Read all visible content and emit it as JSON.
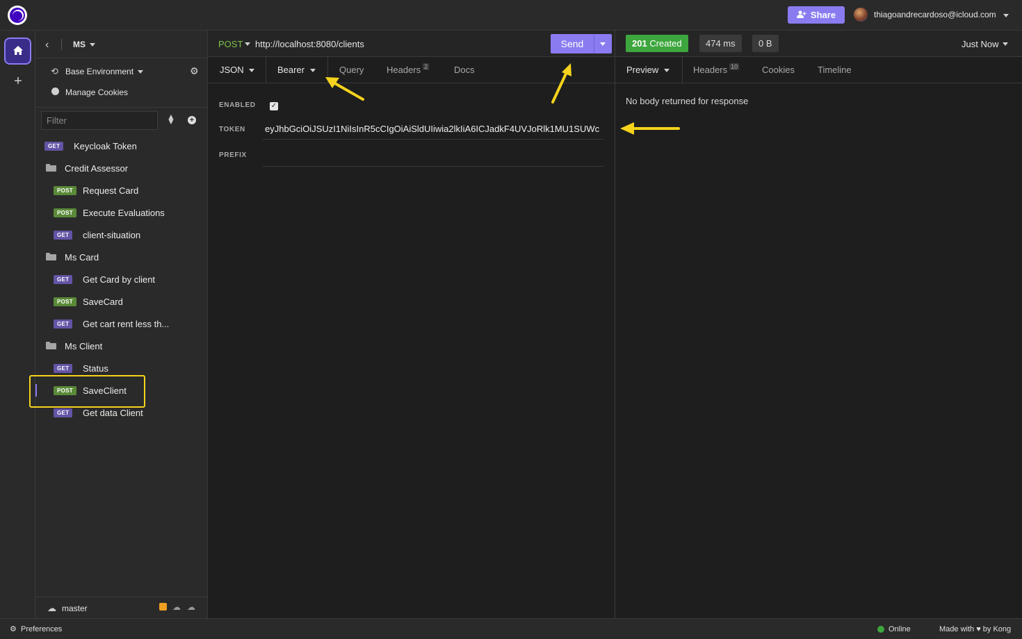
{
  "topbar": {
    "share_label": "Share",
    "user_email": "thiagoandrecardoso@icloud.com"
  },
  "sidebar": {
    "workspace": "MS",
    "environment": "Base Environment",
    "manage_cookies": "Manage Cookies",
    "filter_placeholder": "Filter",
    "items": [
      {
        "type": "request",
        "method": "GET",
        "label": "Keycloak Token",
        "depth": 0
      },
      {
        "type": "folder",
        "label": "Credit Assessor",
        "depth": 0
      },
      {
        "type": "request",
        "method": "POST",
        "label": "Request Card",
        "depth": 1
      },
      {
        "type": "request",
        "method": "POST",
        "label": "Execute Evaluations",
        "depth": 1
      },
      {
        "type": "request",
        "method": "GET",
        "label": "client-situation",
        "depth": 1
      },
      {
        "type": "folder",
        "label": "Ms Card",
        "depth": 0
      },
      {
        "type": "request",
        "method": "GET",
        "label": "Get Card by client",
        "depth": 1
      },
      {
        "type": "request",
        "method": "POST",
        "label": "SaveCard",
        "depth": 1
      },
      {
        "type": "request",
        "method": "GET",
        "label": "Get cart rent less th...",
        "depth": 1
      },
      {
        "type": "folder",
        "label": "Ms Client",
        "depth": 0
      },
      {
        "type": "request",
        "method": "GET",
        "label": "Status",
        "depth": 1
      },
      {
        "type": "request",
        "method": "POST",
        "label": "SaveClient",
        "depth": 1,
        "active": true
      },
      {
        "type": "request",
        "method": "GET",
        "label": "Get data Client",
        "depth": 1
      }
    ],
    "branch": "master"
  },
  "request": {
    "method": "POST",
    "url": "http://localhost:8080/clients",
    "send_label": "Send",
    "tabs": {
      "body": "JSON",
      "auth": "Bearer",
      "query": "Query",
      "headers": "Headers",
      "headers_count": "2",
      "docs": "Docs"
    },
    "auth": {
      "enabled_label": "ENABLED",
      "enabled": true,
      "token_label": "TOKEN",
      "token_value": "eyJhbGciOiJSUzI1NiIsInR5cCIgOiAiSldUIiwia2lkIiA6ICJadkF4UVJoRlk1MU1SUWc",
      "prefix_label": "PREFIX",
      "prefix_value": ""
    }
  },
  "response": {
    "status_code": "201",
    "status_text": "Created",
    "time": "474 ms",
    "size": "0 B",
    "history": "Just Now",
    "tabs": {
      "preview": "Preview",
      "headers": "Headers",
      "headers_count": "10",
      "cookies": "Cookies",
      "timeline": "Timeline"
    },
    "body_message": "No body returned for response"
  },
  "footer": {
    "preferences": "Preferences",
    "status": "Online",
    "made_with_prefix": "Made with",
    "made_with_suffix": "by Kong"
  },
  "colors": {
    "accent": "#8a7cf0",
    "success": "#3da63d",
    "annotation": "#f5d31c"
  }
}
